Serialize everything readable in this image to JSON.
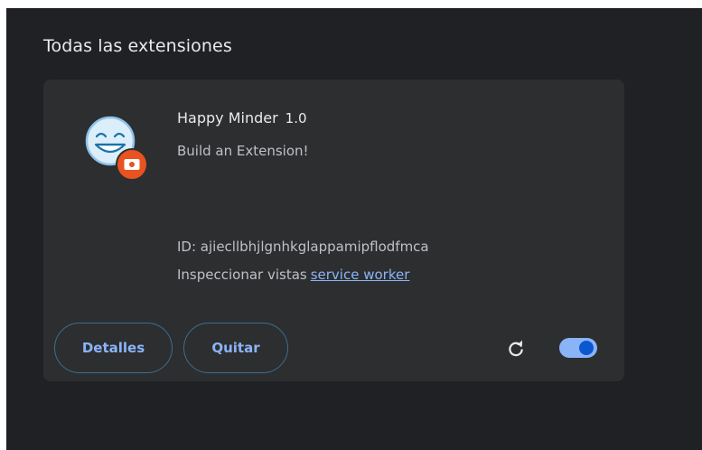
{
  "section": {
    "title": "Todas las extensiones"
  },
  "extension": {
    "icon": "happy-face-icon",
    "badge_icon": "unpacked-extension-icon",
    "name": "Happy Minder",
    "version": "1.0",
    "description": "Build an Extension!",
    "id_line": "ID: ajiecllbhjlgnhkglappamipflodfmca",
    "inspect_label": "Inspeccionar vistas",
    "inspect_link": "service worker",
    "enabled": true
  },
  "buttons": {
    "details_label": "Detalles",
    "remove_label": "Quitar",
    "reload_icon": "reload-icon"
  },
  "colors": {
    "page_bg": "#202124",
    "card_bg": "#2d2e30",
    "accent": "#8ab4f8",
    "toggle_knob": "#0b57d0",
    "badge": "#e8531f"
  }
}
